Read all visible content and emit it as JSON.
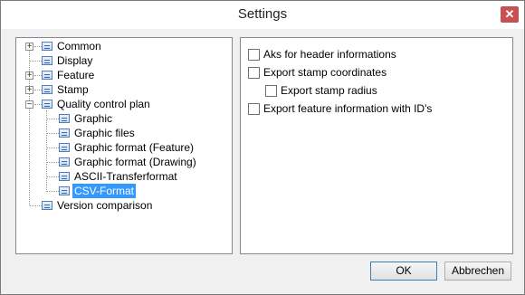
{
  "window": {
    "title": "Settings",
    "close_glyph": "✕"
  },
  "tree": {
    "nodes": [
      {
        "label": "Common",
        "expander": "+",
        "icon": "settings-page-icon"
      },
      {
        "label": "Display",
        "icon": "settings-page-icon"
      },
      {
        "label": "Feature",
        "expander": "+",
        "icon": "settings-page-icon"
      },
      {
        "label": "Stamp",
        "expander": "+",
        "icon": "settings-page-icon"
      },
      {
        "label": "Quality control plan",
        "expander": "−",
        "icon": "settings-page-icon"
      },
      {
        "label": "Graphic",
        "icon": "settings-page-icon"
      },
      {
        "label": "Graphic files",
        "icon": "settings-page-icon"
      },
      {
        "label": "Graphic format (Feature)",
        "icon": "settings-page-icon"
      },
      {
        "label": "Graphic format (Drawing)",
        "icon": "settings-page-icon"
      },
      {
        "label": "ASCII-Transferformat",
        "icon": "settings-page-icon"
      },
      {
        "label": "CSV-Format",
        "icon": "settings-page-icon",
        "selected": true
      },
      {
        "label": "Version comparison",
        "icon": "settings-page-icon"
      }
    ]
  },
  "options": [
    {
      "label": "Aks for header informations",
      "checked": false
    },
    {
      "label": "Export stamp coordinates",
      "checked": false
    },
    {
      "label": "Export stamp radius",
      "checked": false
    },
    {
      "label": "Export feature information with ID's",
      "checked": false
    }
  ],
  "buttons": {
    "ok": "OK",
    "cancel": "Abbrechen"
  },
  "colors": {
    "selection": "#3399ff",
    "close": "#c75050"
  }
}
